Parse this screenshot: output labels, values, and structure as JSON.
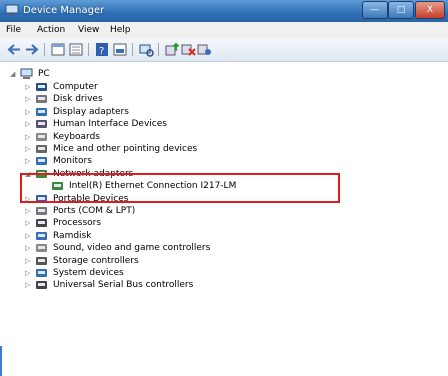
{
  "window": {
    "title": "Device Manager",
    "controls": {
      "minimize": "—",
      "maximize": "□",
      "close": "X"
    }
  },
  "menu": [
    "File",
    "Action",
    "View",
    "Help"
  ],
  "toolbar": {
    "icons": [
      "back-icon",
      "forward-icon",
      "properties-icon",
      "device-view-icon",
      "help-icon",
      "show-hidden-icon",
      "scan-hardware-icon",
      "update-driver-icon",
      "uninstall-icon",
      "enable-device-icon"
    ]
  },
  "tree": {
    "root": "PC",
    "categories": [
      "Computer",
      "Disk drives",
      "Display adapters",
      "Human Interface Devices",
      "Keyboards",
      "Mice and other pointing devices",
      "Monitors",
      "Network adapters",
      "Intel(R) Ethernet Connection I217-LM",
      "Portable Devices",
      "Ports (COM & LPT)",
      "Processors",
      "Ramdisk",
      "Sound, video and game controllers",
      "Storage controllers",
      "System devices",
      "Universal Serial Bus controllers"
    ]
  },
  "colors": {
    "titlebar": "#2f6fb5",
    "highlight_border": "#e01c1c"
  }
}
